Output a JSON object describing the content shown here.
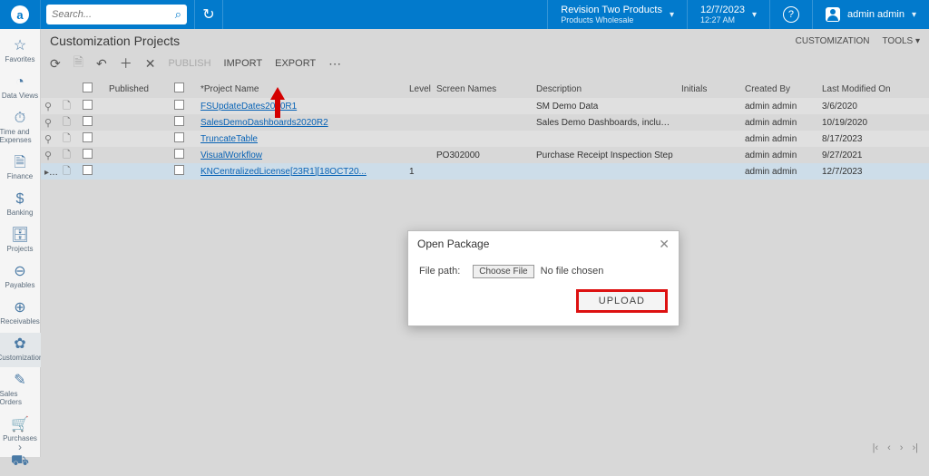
{
  "top": {
    "search_placeholder": "Search...",
    "tenant_title": "Revision Two Products",
    "tenant_sub": "Products Wholesale",
    "date": "12/7/2023",
    "time": "12:27 AM",
    "user": "admin admin"
  },
  "leftnav": [
    {
      "icon": "☆",
      "label": "Favorites"
    },
    {
      "icon": "◔",
      "label": "Data Views"
    },
    {
      "icon": "⏱",
      "label": "Time and Expenses"
    },
    {
      "icon": "🗎",
      "label": "Finance"
    },
    {
      "icon": "$",
      "label": "Banking"
    },
    {
      "icon": "🗄",
      "label": "Projects"
    },
    {
      "icon": "⊖",
      "label": "Payables"
    },
    {
      "icon": "⊕",
      "label": "Receivables"
    },
    {
      "icon": "✿",
      "label": "Customization",
      "active": true
    },
    {
      "icon": "✎",
      "label": "Sales Orders"
    },
    {
      "icon": "🛒",
      "label": "Purchases"
    },
    {
      "icon": "⛟",
      "label": ""
    }
  ],
  "page": {
    "title": "Customization Projects",
    "right_links": {
      "customization": "CUSTOMIZATION",
      "tools": "TOOLS ▾"
    }
  },
  "toolbar": {
    "publish": "PUBLISH",
    "import": "IMPORT",
    "export": "EXPORT"
  },
  "grid": {
    "headers": {
      "published": "Published",
      "project": "*Project Name",
      "level": "Level",
      "screens": "Screen Names",
      "desc": "Description",
      "initials": "Initials",
      "cby": "Created By",
      "mod": "Last Modified On"
    },
    "rows": [
      {
        "name": "FSUpdateDates2020R1",
        "level": "",
        "screens": "",
        "desc": "SM Demo Data",
        "cby": "admin admin",
        "mod": "3/6/2020"
      },
      {
        "name": "SalesDemoDashboards2020R2",
        "level": "",
        "screens": "",
        "desc": "Sales Demo Dashboards, including con...",
        "cby": "admin admin",
        "mod": "10/19/2020"
      },
      {
        "name": "TruncateTable",
        "level": "",
        "screens": "",
        "desc": "",
        "cby": "admin admin",
        "mod": "8/17/2023"
      },
      {
        "name": "VisualWorkflow",
        "level": "",
        "screens": "PO302000",
        "desc": "Purchase Receipt Inspection Step",
        "cby": "admin admin",
        "mod": "9/27/2021"
      },
      {
        "name": "KNCentralizedLicense[23R1][18OCT20...",
        "level": "1",
        "screens": "",
        "desc": "",
        "cby": "admin admin",
        "mod": "12/7/2023",
        "selected": true
      }
    ]
  },
  "modal": {
    "title": "Open Package",
    "file_label": "File path:",
    "choose": "Choose File",
    "nofile": "No file chosen",
    "upload": "UPLOAD"
  },
  "pager": {
    "p1": "|‹",
    "p2": "‹",
    "p3": "›",
    "p4": "›|"
  }
}
